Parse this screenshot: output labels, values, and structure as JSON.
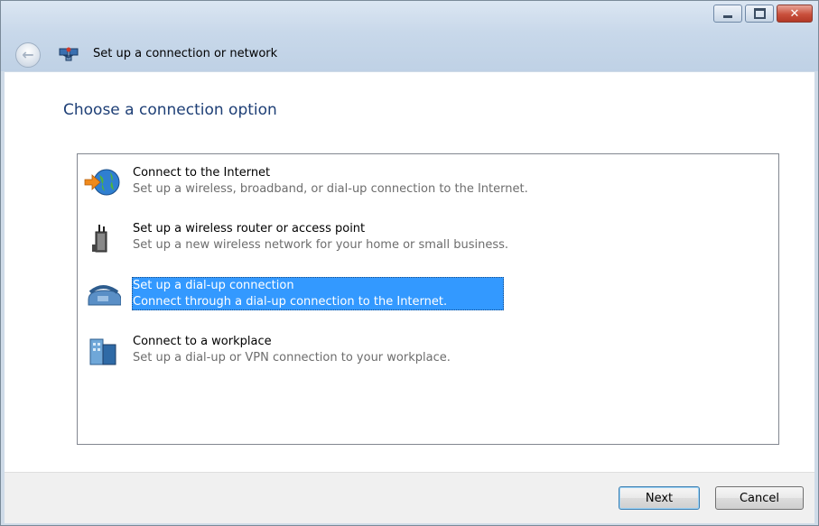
{
  "window": {
    "title": "Set up a connection or network",
    "controls": {
      "minimize_icon": "minimize-icon",
      "maximize_icon": "maximize-icon",
      "close_label": "✕"
    }
  },
  "main": {
    "heading": "Choose a connection option",
    "options": [
      {
        "title": "Connect to the Internet",
        "description": "Set up a wireless, broadband, or dial-up connection to the Internet.",
        "icon": "globe-icon",
        "selected": false
      },
      {
        "title": "Set up a wireless router or access point",
        "description": "Set up a new wireless network for your home or small business.",
        "icon": "router-icon",
        "selected": false
      },
      {
        "title": "Set up a dial-up connection",
        "description": "Connect through a dial-up connection to the Internet.",
        "icon": "telephone-icon",
        "selected": true
      },
      {
        "title": "Connect to a workplace",
        "description": "Set up a dial-up or VPN connection to your workplace.",
        "icon": "workplace-icon",
        "selected": false
      }
    ]
  },
  "footer": {
    "next_label": "Next",
    "cancel_label": "Cancel"
  },
  "colors": {
    "heading": "#1e3f76",
    "selection": "#3399ff",
    "description_text": "#6d6d6d"
  }
}
